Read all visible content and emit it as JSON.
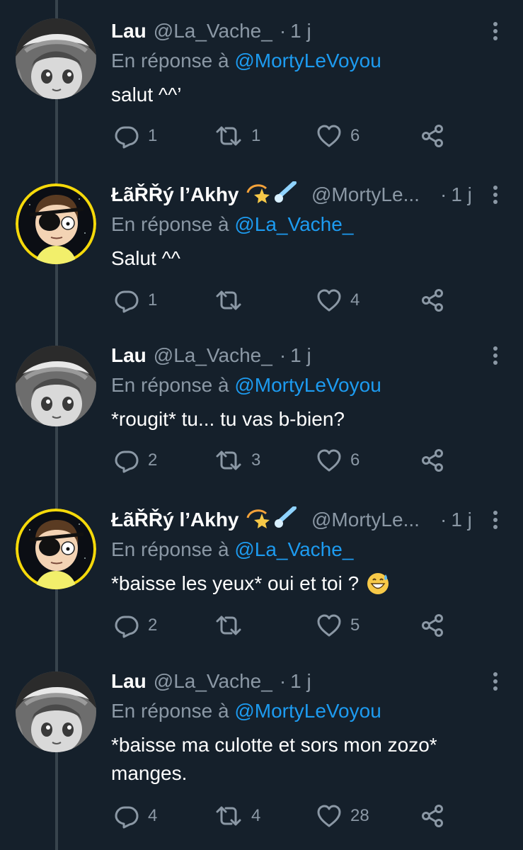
{
  "tweets": [
    {
      "name": "Lau",
      "handle": "@La_Vache_",
      "time": "1 j",
      "reply_prefix": "En réponse à",
      "reply_mention": "@MortyLeVoyou",
      "text": "salut ^^’",
      "replies": "1",
      "retweets": "1",
      "likes": "6",
      "avatar": "manga-girl-avatar"
    },
    {
      "name": "ŁãŘŘý l’Akhy",
      "handle": "@MortyLe...",
      "time": "1 j",
      "reply_prefix": "En réponse à",
      "reply_mention": "@La_Vache_",
      "text": "Salut ^^",
      "replies": "1",
      "retweets": "",
      "likes": "4",
      "avatar": "morty-eyepatch-avatar",
      "name_emojis": [
        "dizzy-star-emoji",
        "comet-emoji"
      ]
    },
    {
      "name": "Lau",
      "handle": "@La_Vache_",
      "time": "1 j",
      "reply_prefix": "En réponse à",
      "reply_mention": "@MortyLeVoyou",
      "text": "*rougit* tu... tu vas b-bien?",
      "replies": "2",
      "retweets": "3",
      "likes": "6",
      "avatar": "manga-girl-avatar"
    },
    {
      "name": "ŁãŘŘý l’Akhy",
      "handle": "@MortyLe...",
      "time": "1 j",
      "reply_prefix": "En réponse à",
      "reply_mention": "@La_Vache_",
      "text": "*baisse les yeux* oui et toi ?",
      "text_emoji": "grinning-sweat-emoji",
      "replies": "2",
      "retweets": "",
      "likes": "5",
      "avatar": "morty-eyepatch-avatar",
      "name_emojis": [
        "dizzy-star-emoji",
        "comet-emoji"
      ]
    },
    {
      "name": "Lau",
      "handle": "@La_Vache_",
      "time": "1 j",
      "reply_prefix": "En réponse à",
      "reply_mention": "@MortyLeVoyou",
      "text_line1": "*baisse ma culotte et sors mon zozo*",
      "text_line2": "manges.",
      "replies": "4",
      "retweets": "4",
      "likes": "28",
      "avatar": "manga-girl-avatar"
    }
  ],
  "colors": {
    "background": "#15202b",
    "muted": "#8b98a5",
    "mention": "#1d9bf0",
    "thread_line": "#38444d"
  }
}
